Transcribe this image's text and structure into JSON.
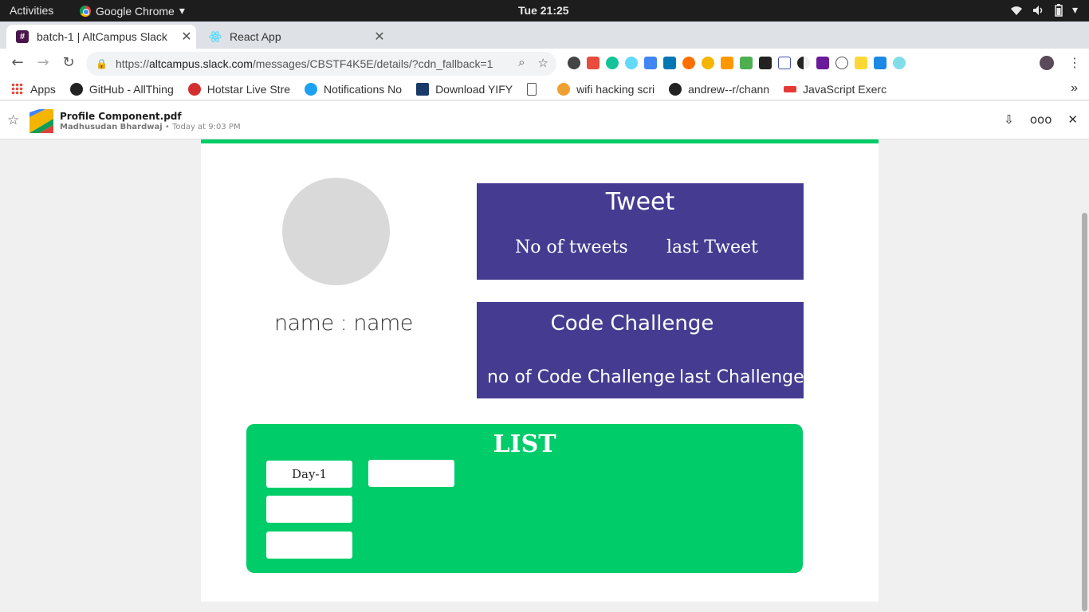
{
  "system_bar": {
    "activities": "Activities",
    "app_name": "Google Chrome",
    "clock": "Tue 21:25"
  },
  "tabs": [
    {
      "label": "batch-1 | AltCampus Slack",
      "active": true
    },
    {
      "label": "React App",
      "active": false
    }
  ],
  "toolbar": {
    "url_prefix": "https://",
    "url_host": "altcampus.slack.com",
    "url_path": "/messages/CBSTF4K5E/details/?cdn_fallback=1"
  },
  "bookmarks": [
    {
      "label": "Apps",
      "icon": "apps-grid-icon",
      "color": "#4285f4"
    },
    {
      "label": "GitHub - AllThing",
      "icon": "github-icon",
      "color": "#222222"
    },
    {
      "label": "Hotstar Live Stre",
      "icon": "hotstar-icon",
      "color": "#d32f2f"
    },
    {
      "label": "Notifications No",
      "icon": "twitter-icon",
      "color": "#1da1f2"
    },
    {
      "label": "Download YIFY",
      "icon": "yify-icon",
      "color": "#1a3a6a"
    },
    {
      "label": "",
      "icon": "page-icon",
      "color": "#ffffff"
    },
    {
      "label": "wifi hacking scri",
      "icon": "globe-icon",
      "color": "#f0a030"
    },
    {
      "label": "andrew--r/chann",
      "icon": "github-icon",
      "color": "#222222"
    },
    {
      "label": "JavaScript Exerc",
      "icon": "w3resource-icon",
      "color": "#e53935"
    }
  ],
  "file_header": {
    "file_name": "Profile Component.pdf",
    "author": "Madhusudan Bhardwaj",
    "separator": "•",
    "timestamp": "Today at 9:03 PM"
  },
  "profile": {
    "name_label": "name : name"
  },
  "tweet_card": {
    "title": "Tweet",
    "left_stat": "No of tweets",
    "right_stat": "last Tweet",
    "color": "#453c91"
  },
  "code_card": {
    "title": "Code Challenge",
    "left_stat": "no of Code Challenge",
    "right_stat": "last Challenge",
    "color": "#453c91"
  },
  "list_panel": {
    "title": "LIST",
    "color": "#00cc6a",
    "items": [
      "Day-1",
      "",
      "",
      ""
    ]
  }
}
